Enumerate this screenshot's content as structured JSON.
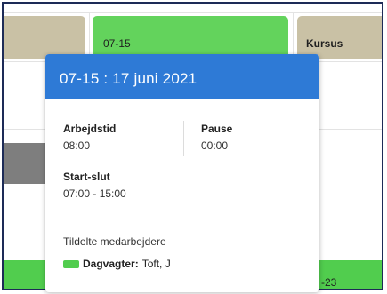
{
  "calendar": {
    "top_cell_label": "07-15",
    "kursus_label": "Kursus",
    "bottom_cell_label": "-23",
    "colors": {
      "tan": "#c9c1a5",
      "green": "#63d35c",
      "gray": "#7e7e7e"
    }
  },
  "popup": {
    "title": "07-15 : 17 juni 2021",
    "header_color": "#2e7ad6",
    "work_time_label": "Arbejdstid",
    "work_time_value": "08:00",
    "pause_label": "Pause",
    "pause_value": "00:00",
    "start_end_label": "Start-slut",
    "start_end_value": "07:00 - 15:00",
    "assigned_label": "Tildelte medarbejdere",
    "employees": [
      {
        "role": "Dagvagter:",
        "name": "Toft, J",
        "color": "#51cd4e"
      }
    ]
  }
}
